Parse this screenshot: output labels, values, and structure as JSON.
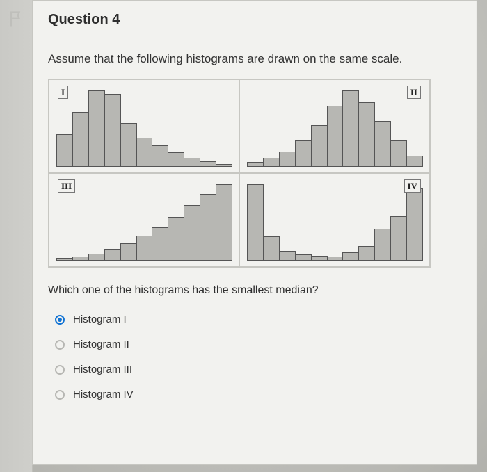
{
  "question_title": "Question 4",
  "prompt": "Assume that the following histograms are drawn on the same scale.",
  "followup": "Which one of the histograms has the smallest median?",
  "chart_data": [
    {
      "type": "bar",
      "label": "I",
      "label_side": "left",
      "values": [
        45,
        75,
        105,
        100,
        60,
        40,
        30,
        20,
        12,
        8,
        4
      ]
    },
    {
      "type": "bar",
      "label": "II",
      "label_side": "right",
      "values": [
        6,
        12,
        20,
        35,
        55,
        80,
        100,
        85,
        60,
        35,
        15
      ]
    },
    {
      "type": "bar",
      "label": "III",
      "label_side": "left",
      "values": [
        4,
        6,
        10,
        16,
        24,
        34,
        46,
        60,
        76,
        92,
        105
      ]
    },
    {
      "type": "bar",
      "label": "IV",
      "label_side": "right",
      "values": [
        95,
        30,
        12,
        8,
        6,
        5,
        10,
        18,
        40,
        55,
        90
      ]
    }
  ],
  "options": [
    {
      "label": "Histogram I",
      "selected": true
    },
    {
      "label": "Histogram II",
      "selected": false
    },
    {
      "label": "Histogram III",
      "selected": false
    },
    {
      "label": "Histogram IV",
      "selected": false
    }
  ]
}
